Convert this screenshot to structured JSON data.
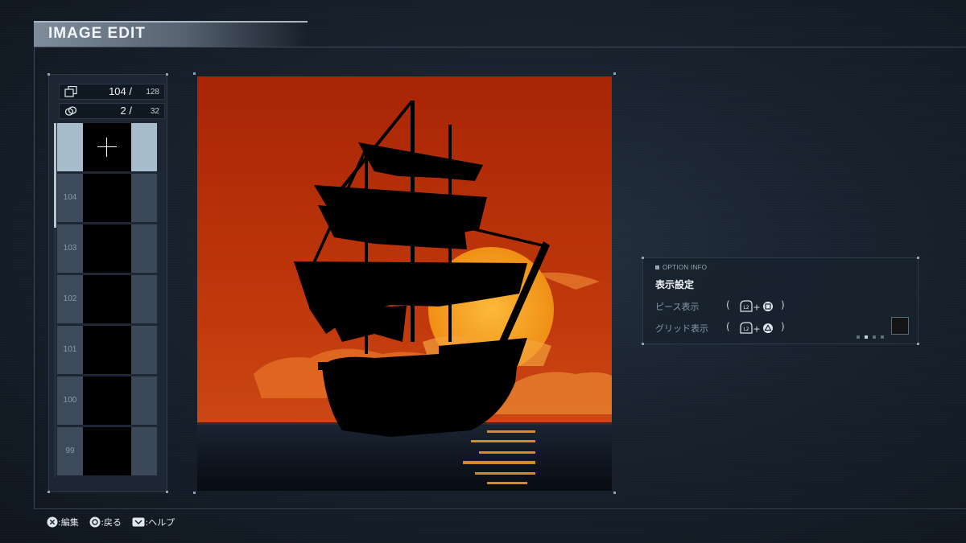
{
  "header": {
    "title": "IMAGE EDIT"
  },
  "counters": {
    "pieces": {
      "current": "104 /",
      "max": "128",
      "icon": "layers-icon"
    },
    "groups": {
      "current": "2 /",
      "max": "32",
      "icon": "link-icon"
    }
  },
  "slots": [
    {
      "id": "",
      "selected": true
    },
    {
      "id": "104"
    },
    {
      "id": "103"
    },
    {
      "id": "102"
    },
    {
      "id": "101"
    },
    {
      "id": "100"
    },
    {
      "id": "99"
    }
  ],
  "canvas": {
    "subject": "pirate-ship-silhouette-at-sunset",
    "colors": {
      "sky": "#b22a06",
      "sun": "#f5a21f",
      "sea": "#0d1420"
    }
  },
  "option_info": {
    "heading": "OPTION INFO",
    "title": "表示設定",
    "rows": [
      {
        "label": "ピース表示",
        "paren_open": "(",
        "paren_close": ")",
        "buttons": [
          "L2",
          "+",
          "square"
        ]
      },
      {
        "label": "グリッド表示",
        "paren_open": "(",
        "paren_close": ")",
        "buttons": [
          "L2",
          "+",
          "triangle"
        ]
      }
    ]
  },
  "footer": {
    "hints": [
      {
        "button": "cross",
        "label": ":編集"
      },
      {
        "button": "circle",
        "label": ":戻る"
      },
      {
        "button": "touchpad",
        "label": ":ヘルプ"
      }
    ]
  }
}
